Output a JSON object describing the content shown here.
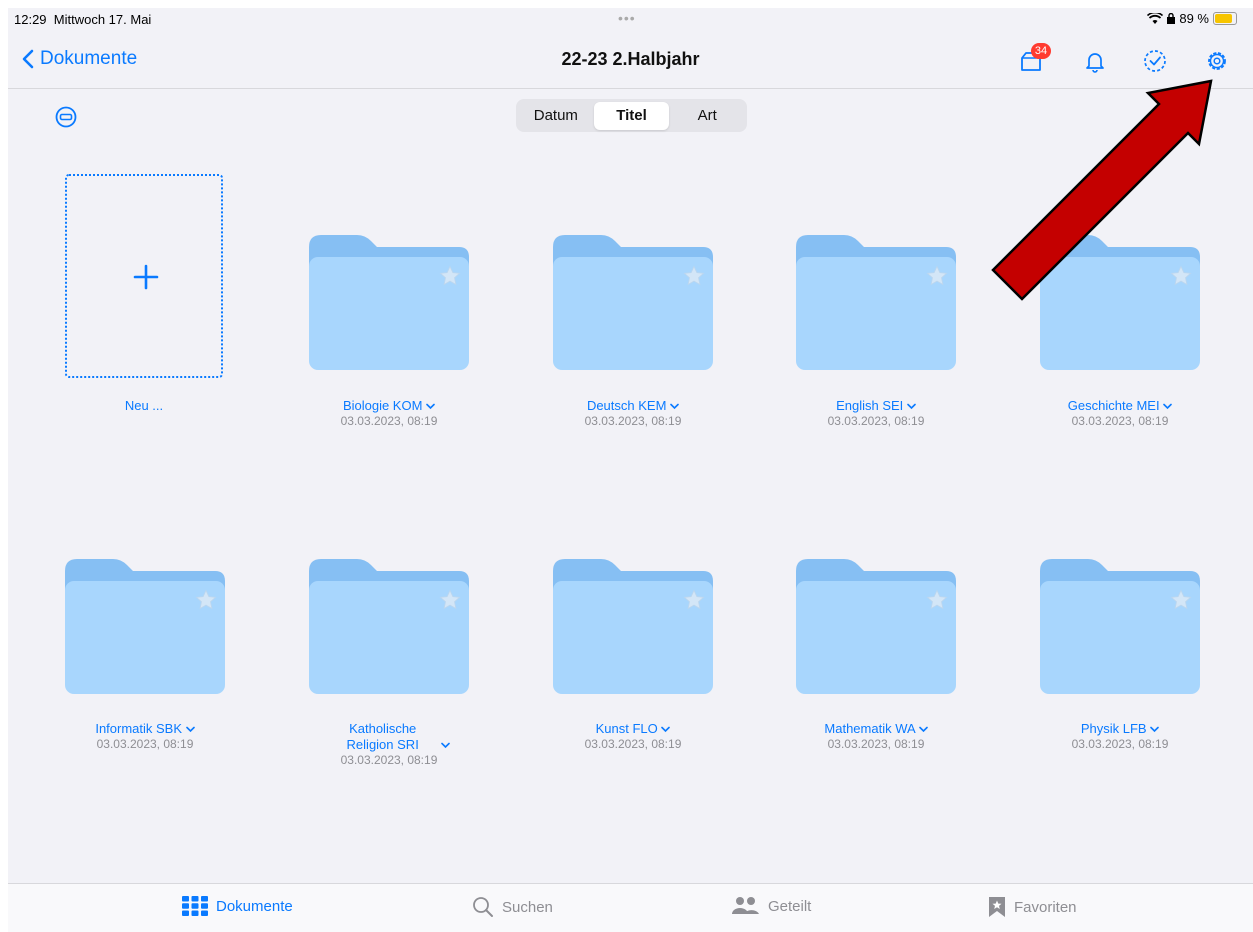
{
  "status": {
    "time": "12:29",
    "date": "Mittwoch 17. Mai",
    "battery": "89 %",
    "dots": "•••"
  },
  "nav": {
    "back_label": "Dokumente",
    "title": "22-23 2.Halbjahr",
    "badge_count": "34"
  },
  "sort": {
    "options": [
      "Datum",
      "Titel",
      "Art"
    ],
    "selected": "Titel"
  },
  "new_tile": {
    "label": "Neu ..."
  },
  "folders": [
    {
      "name": "Biologie KOM",
      "date": "03.03.2023, 08:19"
    },
    {
      "name": "Deutsch KEM",
      "date": "03.03.2023, 08:19"
    },
    {
      "name": "English SEI",
      "date": "03.03.2023, 08:19"
    },
    {
      "name": "Geschichte MEI",
      "date": "03.03.2023, 08:19"
    },
    {
      "name": "Informatik SBK",
      "date": "03.03.2023, 08:19"
    },
    {
      "name": "Katholische Religion SRI",
      "date": "03.03.2023, 08:19"
    },
    {
      "name": "Kunst FLO",
      "date": "03.03.2023, 08:19"
    },
    {
      "name": "Mathematik WA",
      "date": "03.03.2023, 08:19"
    },
    {
      "name": "Physik LFB",
      "date": "03.03.2023, 08:19"
    }
  ],
  "tabs": [
    {
      "label": "Dokumente",
      "icon": "grid-icon",
      "active": true
    },
    {
      "label": "Suchen",
      "icon": "search-icon",
      "active": false
    },
    {
      "label": "Geteilt",
      "icon": "people-icon",
      "active": false
    },
    {
      "label": "Favoriten",
      "icon": "bookmark-star-icon",
      "active": false
    }
  ],
  "colors": {
    "accent": "#0a7aff",
    "folder_front": "#a8d6fd",
    "folder_back": "#86bff3",
    "badge": "#ff3b30",
    "arrow": "#c40000"
  }
}
